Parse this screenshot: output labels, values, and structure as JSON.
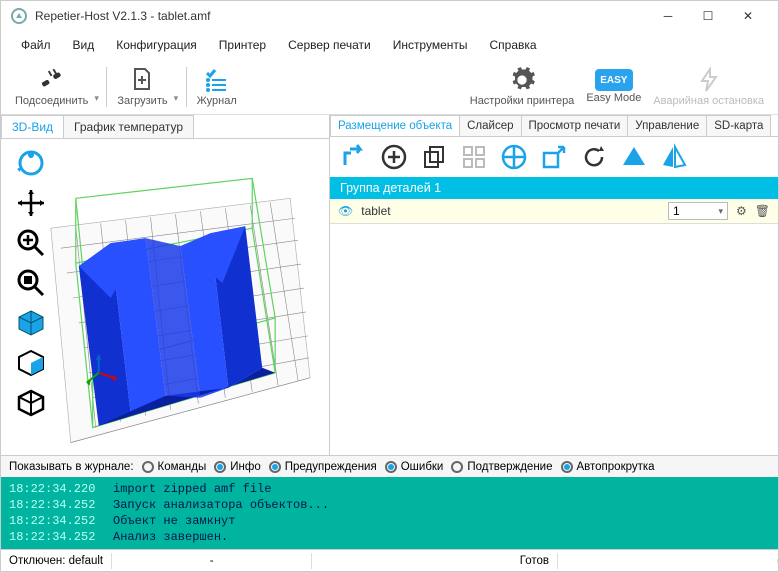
{
  "title": "Repetier-Host V2.1.3 - tablet.amf",
  "menu": {
    "file": "Файл",
    "view": "Вид",
    "config": "Конфигурация",
    "printer": "Принтер",
    "printserver": "Сервер печати",
    "tools": "Инструменты",
    "help": "Справка"
  },
  "toolbar": {
    "connect": "Подсоединить",
    "load": "Загрузить",
    "log": "Журнал",
    "psettings": "Настройки принтера",
    "easy": "Easy Mode",
    "easyBadge": "EASY",
    "emergency": "Аварийная остановка"
  },
  "leftTabs": {
    "view3d": "3D-Вид",
    "tempgraph": "График температур"
  },
  "rightTabs": {
    "placement": "Размещение объекта",
    "slicer": "Слайсер",
    "preview": "Просмотр печати",
    "control": "Управление",
    "sdcard": "SD-карта"
  },
  "group": {
    "header": "Группа деталей 1"
  },
  "object": {
    "name": "tablet",
    "qty": "1"
  },
  "logFilter": {
    "label": "Показывать в журнале:",
    "commands": "Команды",
    "info": "Инфо",
    "warnings": "Предупреждения",
    "errors": "Ошибки",
    "ack": "Подтверждение",
    "autoscroll": "Автопрокрутка"
  },
  "logLines": [
    {
      "ts": "18:22:34.220",
      "msg": "import zipped amf file"
    },
    {
      "ts": "18:22:34.252",
      "msg": "Запуск анализатора объектов..."
    },
    {
      "ts": "18:22:34.252",
      "msg": "Объект не замкнут"
    },
    {
      "ts": "18:22:34.252",
      "msg": "Анализ завершен."
    }
  ],
  "status": {
    "disconnected": "Отключен: default",
    "dash": "-",
    "ready": "Готов"
  }
}
